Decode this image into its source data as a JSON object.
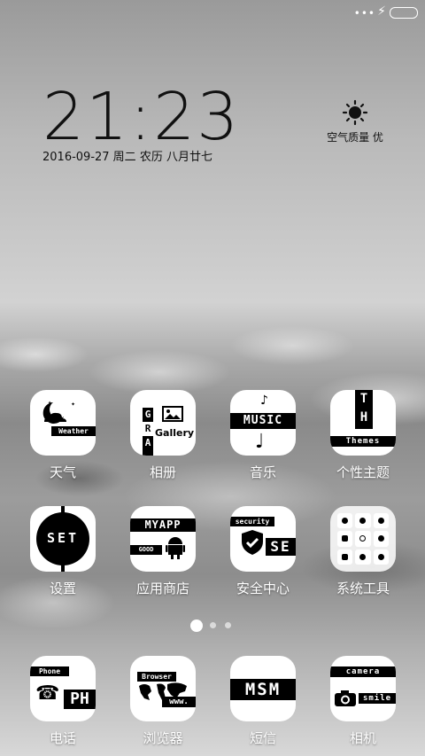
{
  "status_bar": {
    "dots": "•••"
  },
  "clock": {
    "time": "21:23",
    "date": "2016-09-27 周二 农历 八月廿七"
  },
  "weather_widget": {
    "icon": "sun-icon",
    "aqi": "空气质量 优"
  },
  "apps": {
    "weather": {
      "label": "天气",
      "tile_text": "Weather"
    },
    "gallery": {
      "label": "相册",
      "tile_text": "Gallery",
      "g": "G",
      "r": "R",
      "a": "A"
    },
    "music": {
      "label": "音乐",
      "tile_text": "MUSIC"
    },
    "themes": {
      "label": "个性主题",
      "tile_text": "Themes",
      "t": "T",
      "h": "H"
    },
    "settings": {
      "label": "设置",
      "tile_text": "SET"
    },
    "appstore": {
      "label": "应用商店",
      "tile_text": "MYAPP",
      "sub": "GOOD"
    },
    "security": {
      "label": "安全中心",
      "tile_text": "SE",
      "sub": "security"
    },
    "tools": {
      "label": "系统工具"
    },
    "phone": {
      "label": "电话",
      "tile_text": "PH",
      "sub": "Phone"
    },
    "browser": {
      "label": "浏览器",
      "tile_text": "Browser",
      "sub": "www."
    },
    "sms": {
      "label": "短信",
      "tile_text": "MSM"
    },
    "camera": {
      "label": "相机",
      "tile_text": "camera",
      "sub": "smile"
    }
  },
  "page_indicator": {
    "count": 3,
    "active": 0
  }
}
